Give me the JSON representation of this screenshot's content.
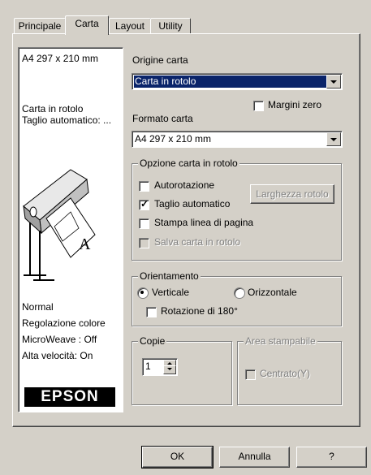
{
  "tabs": [
    {
      "label": "Principale"
    },
    {
      "label": "Carta"
    },
    {
      "label": "Layout"
    },
    {
      "label": "Utility"
    }
  ],
  "info": {
    "paper_size": "A4 297 x 210 mm",
    "source_line1": "Carta in rotolo",
    "source_line2": "Taglio automatico: ...",
    "mode": "Normal",
    "color": "Regolazione colore",
    "microweave": "MicroWeave : Off",
    "speed": "Alta velocità: On",
    "brand": "EPSON"
  },
  "paper_source": {
    "label": "Origine carta",
    "value": "Carta in rotolo"
  },
  "zero_margins": {
    "label": "Margini zero",
    "checked": false
  },
  "paper_size": {
    "label": "Formato carta",
    "value": "A4 297 x 210 mm"
  },
  "roll_options": {
    "title": "Opzione carta in rotolo",
    "autorotate": {
      "label": "Autorotazione",
      "checked": false
    },
    "autocut": {
      "label": "Taglio automatico",
      "checked": true
    },
    "print_page_line": {
      "label": "Stampa linea di pagina",
      "checked": false
    },
    "save_roll": {
      "label": "Salva carta in rotolo",
      "checked": false,
      "enabled": false
    },
    "roll_width_button": "Larghezza rotolo"
  },
  "orientation": {
    "title": "Orientamento",
    "portrait": {
      "label": "Verticale",
      "selected": true
    },
    "landscape": {
      "label": "Orizzontale",
      "selected": false
    },
    "rotate180": {
      "label": "Rotazione di 180°",
      "checked": false
    }
  },
  "copies": {
    "title": "Copie",
    "value": "1"
  },
  "printable_area": {
    "title": "Area stampabile",
    "centered_label": "Centrato(Y)",
    "checked": false
  },
  "buttons": {
    "ok": "OK",
    "cancel": "Annulla",
    "help": "?"
  }
}
